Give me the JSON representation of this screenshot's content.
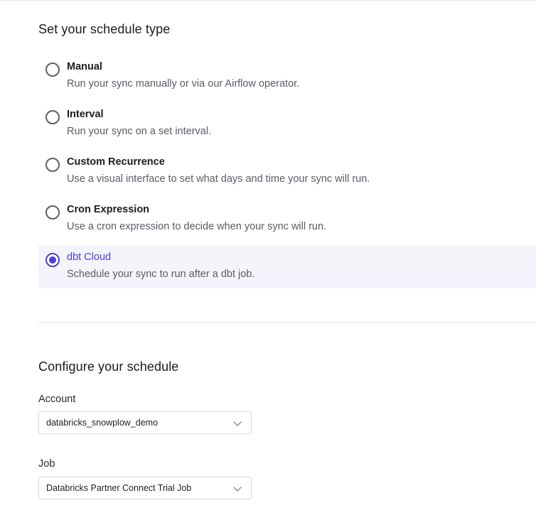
{
  "schedule_type": {
    "title": "Set your schedule type",
    "options": [
      {
        "label": "Manual",
        "description": "Run your sync manually or via our Airflow operator.",
        "selected": false
      },
      {
        "label": "Interval",
        "description": "Run your sync on a set interval.",
        "selected": false
      },
      {
        "label": "Custom Recurrence",
        "description": "Use a visual interface to set what days and time your sync will run.",
        "selected": false
      },
      {
        "label": "Cron Expression",
        "description": "Use a cron expression to decide when your sync will run.",
        "selected": false
      },
      {
        "label": "dbt Cloud",
        "description": "Schedule your sync to run after a dbt job.",
        "selected": true
      }
    ]
  },
  "configure": {
    "title": "Configure your schedule",
    "account": {
      "label": "Account",
      "value": "databricks_snowplow_demo",
      "icon": "chevron-down-icon"
    },
    "job": {
      "label": "Job",
      "value": "Databricks Partner Connect Trial Job",
      "icon": "chevron-down-icon"
    }
  },
  "colors": {
    "accent": "#4f3fd9",
    "selected_bg": "#f4f4fb"
  }
}
